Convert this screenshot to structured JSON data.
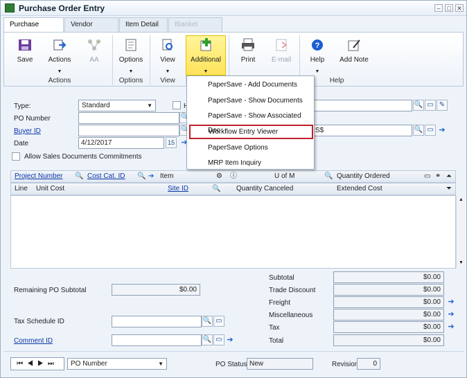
{
  "window": {
    "title": "Purchase Order Entry",
    "minimize": "–",
    "restore": "□",
    "close": "✕"
  },
  "tabs": [
    {
      "label": "Purchase Order"
    },
    {
      "label": "Vendor Detail"
    },
    {
      "label": "Item Detail"
    },
    {
      "label": "Blanket Detail"
    }
  ],
  "ribbon": {
    "buttons": [
      {
        "label": "Save"
      },
      {
        "label": "Actions",
        "arrow": "▼"
      },
      {
        "label": "AA"
      },
      {
        "label": "Options",
        "arrow": "▼"
      },
      {
        "label": "View",
        "arrow": "▼"
      },
      {
        "label": "Additional",
        "arrow": "▼"
      },
      {
        "label": "Print"
      },
      {
        "label": "E-mail"
      },
      {
        "label": "Help",
        "arrow": "▼"
      },
      {
        "label": "Add Note"
      }
    ],
    "groups": {
      "actions": "Actions",
      "options": "Options",
      "view": "View",
      "help": "Help"
    }
  },
  "form": {
    "type_label": "Type:",
    "type_value": "Standard",
    "po_number_label": "PO Number",
    "buyer_id_label": "Buyer ID",
    "date_label": "Date",
    "date_value": "4/12/2017",
    "calendar": "15",
    "allow_sales_label": "Allow Sales Documents Commitments",
    "currency_partial": "S$",
    "hold_partial": "H"
  },
  "grid": {
    "header1": {
      "project_number": "Project Number",
      "cost_cat_id": "Cost Cat. ID",
      "item": "Item",
      "u_of_m": "U of M",
      "quantity_ordered": "Quantity Ordered"
    },
    "header2": {
      "line": "Line",
      "unit_cost": "Unit Cost",
      "site_id": "Site ID",
      "quantity_canceled": "Quantity Canceled",
      "extended_cost": "Extended Cost"
    }
  },
  "totals": {
    "remaining_label": "Remaining PO Subtotal",
    "remaining_value": "$0.00",
    "tax_schedule_label": "Tax Schedule ID",
    "comment_id_label": "Comment ID",
    "subtotal_label": "Subtotal",
    "subtotal_value": "$0.00",
    "trade_discount_label": "Trade Discount",
    "trade_discount_value": "$0.00",
    "freight_label": "Freight",
    "freight_value": "$0.00",
    "misc_label": "Miscellaneous",
    "misc_value": "$0.00",
    "tax_label": "Tax",
    "tax_value": "$0.00",
    "total_label": "Total",
    "total_value": "$0.00"
  },
  "footer": {
    "nav": "⏮◀▶⏭",
    "sort_value": "PO Number",
    "po_status_label": "PO Status",
    "po_status_value": "New",
    "revision_label": "Revision",
    "revision_value": "0"
  },
  "menu": {
    "items": [
      {
        "label": "PaperSave - Add Documents"
      },
      {
        "label": "PaperSave - Show Documents"
      },
      {
        "label": "PaperSave - Show Associated Doc"
      },
      {
        "label": "Workflow Entry Viewer"
      },
      {
        "label": "PaperSave Options"
      },
      {
        "label": "MRP Item Inquiry"
      }
    ]
  },
  "colors": {
    "accent": "#0b37a8",
    "highlight": "#ffe35a",
    "selection_border": "#c0202a"
  }
}
